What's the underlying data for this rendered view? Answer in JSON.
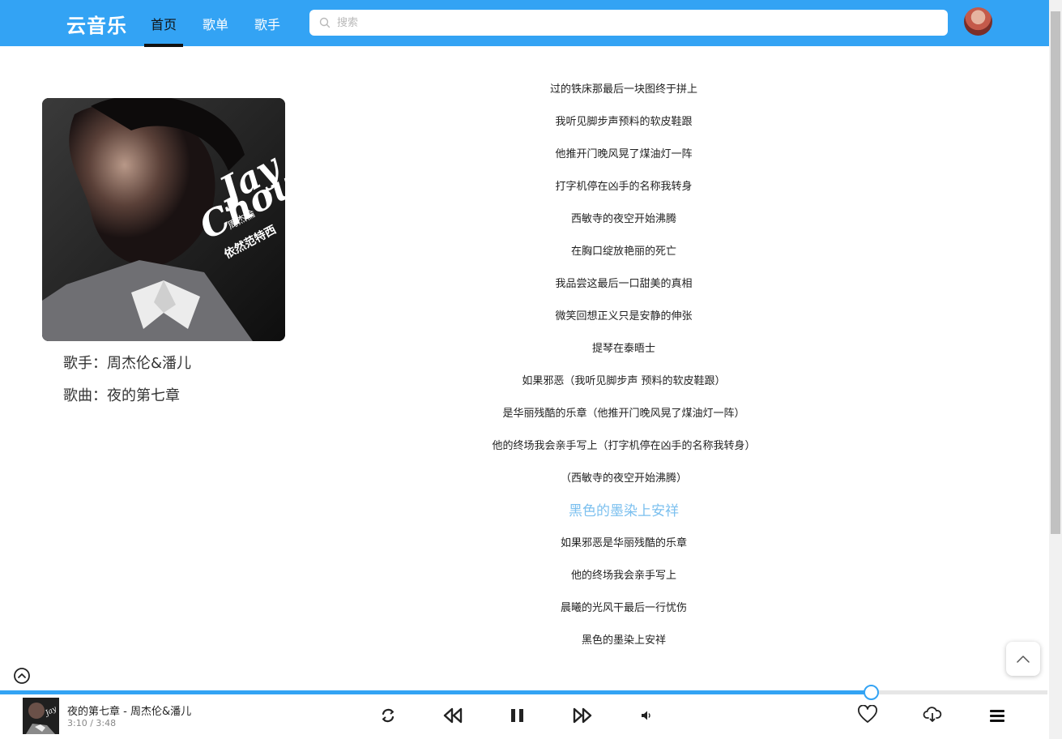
{
  "header": {
    "brand": "云音乐",
    "nav": [
      {
        "label": "首页",
        "active": true
      },
      {
        "label": "歌单",
        "active": false
      },
      {
        "label": "歌手",
        "active": false
      }
    ],
    "search": {
      "placeholder": "搜索",
      "value": ""
    }
  },
  "album": {
    "cover_text": {
      "line1": "Jay",
      "line2": "Chou",
      "cn_name": "周杰倫",
      "album_name": "依然范特西"
    },
    "artist_label": "歌手：周杰伦&潘儿",
    "song_label": "歌曲：夜的第七章"
  },
  "lyrics": {
    "current_index": 13,
    "lines": [
      "过的铁床那最后一块图终于拼上",
      "我听见脚步声预料的软皮鞋跟",
      "他推开门晚风晃了煤油灯一阵",
      "打字机停在凶手的名称我转身",
      "西敏寺的夜空开始沸腾",
      "在胸口绽放艳丽的死亡",
      "我品尝这最后一口甜美的真相",
      "微笑回想正义只是安静的伸张",
      "提琴在泰晤士",
      "如果邪恶（我听见脚步声 预料的软皮鞋跟）",
      "是华丽残酷的乐章（他推开门晚风晃了煤油灯一阵）",
      "他的终场我会亲手写上（打字机停在凶手的名称我转身）",
      "（西敏寺的夜空开始沸腾）",
      "黑色的墨染上安祥",
      "如果邪恶是华丽残酷的乐章",
      "他的终场我会亲手写上",
      "晨曦的光风干最后一行忧伤",
      "黑色的墨染上安祥"
    ]
  },
  "player": {
    "title": "夜的第七章 - 周杰伦&潘儿",
    "time": "3:10 / 3:48",
    "progress": 0.832,
    "accent": "#33a3f4",
    "icons": [
      "loop-icon",
      "previous-icon",
      "pause-icon",
      "next-icon",
      "volume-icon",
      "like-icon",
      "download-icon",
      "playlist-icon"
    ]
  },
  "colors": {
    "header_bg": "#33a3f4",
    "current_lyric": "#7cc0ef"
  }
}
